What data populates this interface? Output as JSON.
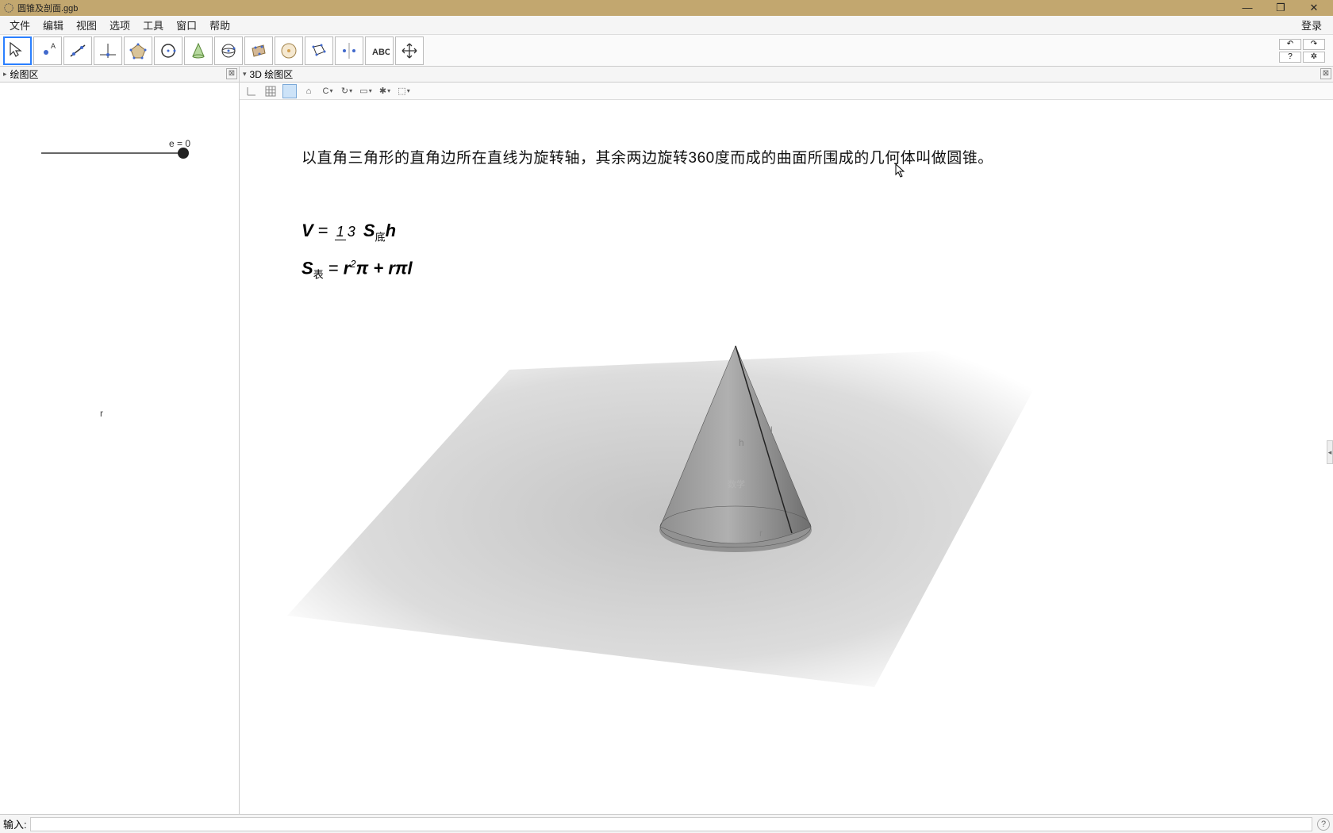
{
  "window": {
    "title": "圆锥及剖面.ggb",
    "minimize": "—",
    "maximize": "❐",
    "close": "✕"
  },
  "menu": {
    "file": "文件",
    "edit": "编辑",
    "view": "视图",
    "options": "选项",
    "tools": "工具",
    "window": "窗口",
    "help": "帮助",
    "login": "登录"
  },
  "toolbar": {
    "undo": "↶",
    "redo": "↷",
    "help_icon": "?",
    "settings_icon": "✲"
  },
  "panels": {
    "left_title": "绘图区",
    "right_title": "3D 绘图区",
    "close": "⊠"
  },
  "graphics": {
    "slider_label": "e = 0",
    "r_label": "r"
  },
  "view3d": {
    "definition": "以直角三角形的直角边所在直线为旋转轴，其余两边旋转360度而成的曲面所围成的几何体叫做圆锥。",
    "formula_V_lhs": "V",
    "formula_V_eq": " = ",
    "frac_num": "1",
    "frac_den": "3",
    "S_di": "S",
    "S_di_sub": "底",
    "h": "h",
    "formula_S_lhs": "S",
    "formula_S_sub": "表",
    "formula_S_rhs": " = r",
    "sq": "2",
    "pi1": "π + rπl",
    "cone_h": "h",
    "cone_l": "l",
    "cone_r": "r",
    "watermark": "数学"
  },
  "inputbar": {
    "label": "输入:",
    "value": "",
    "help": "?"
  }
}
